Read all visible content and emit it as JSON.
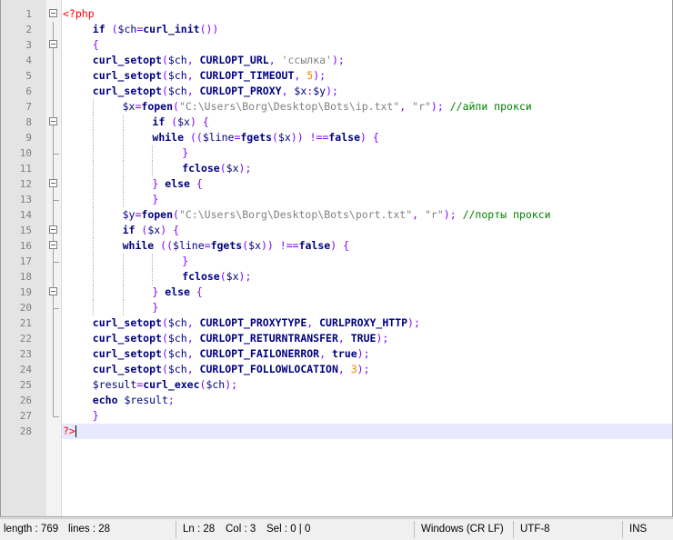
{
  "editor": {
    "current_line": 28,
    "lines": [
      {
        "n": "1",
        "indent": 0,
        "tokens": [
          [
            "tag",
            "<?php"
          ]
        ]
      },
      {
        "n": "2",
        "indent": 4,
        "tokens": [
          [
            "kw",
            "if"
          ],
          [
            "pl",
            " "
          ],
          [
            "op",
            "("
          ],
          [
            "var",
            "$ch"
          ],
          [
            "op",
            "="
          ],
          [
            "fn",
            "curl_init"
          ],
          [
            "op",
            "())"
          ]
        ]
      },
      {
        "n": "3",
        "indent": 4,
        "tokens": [
          [
            "op",
            "{"
          ]
        ]
      },
      {
        "n": "4",
        "indent": 4,
        "tokens": [
          [
            "fn",
            "curl_setopt"
          ],
          [
            "op",
            "("
          ],
          [
            "var",
            "$ch"
          ],
          [
            "op",
            ", "
          ],
          [
            "fn",
            "CURLOPT_URL"
          ],
          [
            "op",
            ", "
          ],
          [
            "str",
            "'ссылка'"
          ],
          [
            "op",
            ");"
          ]
        ]
      },
      {
        "n": "5",
        "indent": 4,
        "tokens": [
          [
            "fn",
            "curl_setopt"
          ],
          [
            "op",
            "("
          ],
          [
            "var",
            "$ch"
          ],
          [
            "op",
            ", "
          ],
          [
            "fn",
            "CURLOPT_TIMEOUT"
          ],
          [
            "op",
            ", "
          ],
          [
            "num",
            "5"
          ],
          [
            "op",
            ");"
          ]
        ]
      },
      {
        "n": "6",
        "indent": 4,
        "tokens": [
          [
            "fn",
            "curl_setopt"
          ],
          [
            "op",
            "("
          ],
          [
            "var",
            "$ch"
          ],
          [
            "op",
            ", "
          ],
          [
            "fn",
            "CURLOPT_PROXY"
          ],
          [
            "op",
            ", "
          ],
          [
            "var",
            "$x"
          ],
          [
            "op",
            ":"
          ],
          [
            "var",
            "$y"
          ],
          [
            "op",
            ");"
          ]
        ]
      },
      {
        "n": "7",
        "indent": 8,
        "tokens": [
          [
            "var",
            "$x"
          ],
          [
            "op",
            "="
          ],
          [
            "fn",
            "fopen"
          ],
          [
            "op",
            "("
          ],
          [
            "str",
            "\"C:\\Users\\Borg\\Desktop\\Bots\\ip.txt\""
          ],
          [
            "op",
            ", "
          ],
          [
            "str",
            "\"r\""
          ],
          [
            "op",
            ");"
          ],
          [
            "pl",
            " "
          ],
          [
            "cmt",
            "//айпи прокси"
          ]
        ]
      },
      {
        "n": "8",
        "indent": 12,
        "tokens": [
          [
            "kw",
            "if"
          ],
          [
            "pl",
            " "
          ],
          [
            "op",
            "("
          ],
          [
            "var",
            "$x"
          ],
          [
            "op",
            ")"
          ],
          [
            "pl",
            " "
          ],
          [
            "op",
            "{"
          ]
        ]
      },
      {
        "n": "9",
        "indent": 12,
        "tokens": [
          [
            "kw",
            "while"
          ],
          [
            "pl",
            " "
          ],
          [
            "op",
            "(("
          ],
          [
            "var",
            "$line"
          ],
          [
            "op",
            "="
          ],
          [
            "fn",
            "fgets"
          ],
          [
            "op",
            "("
          ],
          [
            "var",
            "$x"
          ],
          [
            "op",
            "))"
          ],
          [
            "pl",
            " "
          ],
          [
            "op",
            "!=="
          ],
          [
            "kw",
            "false"
          ],
          [
            "op",
            ")"
          ],
          [
            "pl",
            " "
          ],
          [
            "op",
            "{"
          ]
        ]
      },
      {
        "n": "10",
        "indent": 16,
        "tokens": [
          [
            "op",
            "}"
          ]
        ]
      },
      {
        "n": "11",
        "indent": 16,
        "tokens": [
          [
            "fn",
            "fclose"
          ],
          [
            "op",
            "("
          ],
          [
            "var",
            "$x"
          ],
          [
            "op",
            ");"
          ]
        ]
      },
      {
        "n": "12",
        "indent": 12,
        "tokens": [
          [
            "op",
            "}"
          ],
          [
            "pl",
            " "
          ],
          [
            "kw",
            "else"
          ],
          [
            "pl",
            " "
          ],
          [
            "op",
            "{"
          ]
        ]
      },
      {
        "n": "13",
        "indent": 12,
        "tokens": [
          [
            "op",
            "}"
          ]
        ]
      },
      {
        "n": "14",
        "indent": 8,
        "tokens": [
          [
            "var",
            "$y"
          ],
          [
            "op",
            "="
          ],
          [
            "fn",
            "fopen"
          ],
          [
            "op",
            "("
          ],
          [
            "str",
            "\"C:\\Users\\Borg\\Desktop\\Bots\\port.txt\""
          ],
          [
            "op",
            ", "
          ],
          [
            "str",
            "\"r\""
          ],
          [
            "op",
            ");"
          ],
          [
            "pl",
            " "
          ],
          [
            "cmt",
            "//порты прокси"
          ]
        ]
      },
      {
        "n": "15",
        "indent": 8,
        "tokens": [
          [
            "kw",
            "if"
          ],
          [
            "pl",
            " "
          ],
          [
            "op",
            "("
          ],
          [
            "var",
            "$x"
          ],
          [
            "op",
            ")"
          ],
          [
            "pl",
            " "
          ],
          [
            "op",
            "{"
          ]
        ]
      },
      {
        "n": "16",
        "indent": 8,
        "tokens": [
          [
            "kw",
            "while"
          ],
          [
            "pl",
            " "
          ],
          [
            "op",
            "(("
          ],
          [
            "var",
            "$line"
          ],
          [
            "op",
            "="
          ],
          [
            "fn",
            "fgets"
          ],
          [
            "op",
            "("
          ],
          [
            "var",
            "$x"
          ],
          [
            "op",
            "))"
          ],
          [
            "pl",
            " "
          ],
          [
            "op",
            "!=="
          ],
          [
            "kw",
            "false"
          ],
          [
            "op",
            ")"
          ],
          [
            "pl",
            " "
          ],
          [
            "op",
            "{"
          ]
        ]
      },
      {
        "n": "17",
        "indent": 16,
        "tokens": [
          [
            "op",
            "}"
          ]
        ]
      },
      {
        "n": "18",
        "indent": 16,
        "tokens": [
          [
            "fn",
            "fclose"
          ],
          [
            "op",
            "("
          ],
          [
            "var",
            "$x"
          ],
          [
            "op",
            ");"
          ]
        ]
      },
      {
        "n": "19",
        "indent": 12,
        "tokens": [
          [
            "op",
            "}"
          ],
          [
            "pl",
            " "
          ],
          [
            "kw",
            "else"
          ],
          [
            "pl",
            " "
          ],
          [
            "op",
            "{"
          ]
        ]
      },
      {
        "n": "20",
        "indent": 12,
        "tokens": [
          [
            "op",
            "}"
          ]
        ]
      },
      {
        "n": "21",
        "indent": 4,
        "tokens": [
          [
            "fn",
            "curl_setopt"
          ],
          [
            "op",
            "("
          ],
          [
            "var",
            "$ch"
          ],
          [
            "op",
            ", "
          ],
          [
            "fn",
            "CURLOPT_PROXYTYPE"
          ],
          [
            "op",
            ", "
          ],
          [
            "fn",
            "CURLPROXY_HTTP"
          ],
          [
            "op",
            ");"
          ]
        ]
      },
      {
        "n": "22",
        "indent": 4,
        "tokens": [
          [
            "fn",
            "curl_setopt"
          ],
          [
            "op",
            "("
          ],
          [
            "var",
            "$ch"
          ],
          [
            "op",
            ", "
          ],
          [
            "fn",
            "CURLOPT_RETURNTRANSFER"
          ],
          [
            "op",
            ", "
          ],
          [
            "kw",
            "TRUE"
          ],
          [
            "op",
            ");"
          ]
        ]
      },
      {
        "n": "23",
        "indent": 4,
        "tokens": [
          [
            "fn",
            "curl_setopt"
          ],
          [
            "op",
            "("
          ],
          [
            "var",
            "$ch"
          ],
          [
            "op",
            ", "
          ],
          [
            "fn",
            "CURLOPT_FAILONERROR"
          ],
          [
            "op",
            ", "
          ],
          [
            "kw",
            "true"
          ],
          [
            "op",
            ");"
          ]
        ]
      },
      {
        "n": "24",
        "indent": 4,
        "tokens": [
          [
            "fn",
            "curl_setopt"
          ],
          [
            "op",
            "("
          ],
          [
            "var",
            "$ch"
          ],
          [
            "op",
            ", "
          ],
          [
            "fn",
            "CURLOPT_FOLLOWLOCATION"
          ],
          [
            "op",
            ", "
          ],
          [
            "num",
            "3"
          ],
          [
            "op",
            ");"
          ]
        ]
      },
      {
        "n": "25",
        "indent": 4,
        "tokens": [
          [
            "var",
            "$result"
          ],
          [
            "op",
            "="
          ],
          [
            "fn",
            "curl_exec"
          ],
          [
            "op",
            "("
          ],
          [
            "var",
            "$ch"
          ],
          [
            "op",
            ");"
          ]
        ]
      },
      {
        "n": "26",
        "indent": 4,
        "tokens": [
          [
            "kw",
            "echo"
          ],
          [
            "pl",
            " "
          ],
          [
            "var",
            "$result"
          ],
          [
            "op",
            ";"
          ]
        ]
      },
      {
        "n": "27",
        "indent": 4,
        "tokens": [
          [
            "op",
            "}"
          ]
        ]
      },
      {
        "n": "28",
        "indent": 0,
        "tokens": [
          [
            "tag",
            "?>"
          ]
        ]
      }
    ]
  },
  "statusbar": {
    "length": "length : 769",
    "lines": "lines : 28",
    "ln": "Ln : 28",
    "col": "Col : 3",
    "sel": "Sel : 0 | 0",
    "eol": "Windows (CR LF)",
    "encoding": "UTF-8",
    "mode": "INS"
  },
  "colors": {
    "tag": "#ff0000",
    "operator": "#8000ff",
    "keyword": "#000080",
    "string": "#808080",
    "number": "#ff8000",
    "comment": "#008000",
    "current_line_bg": "#e8e8ff"
  }
}
